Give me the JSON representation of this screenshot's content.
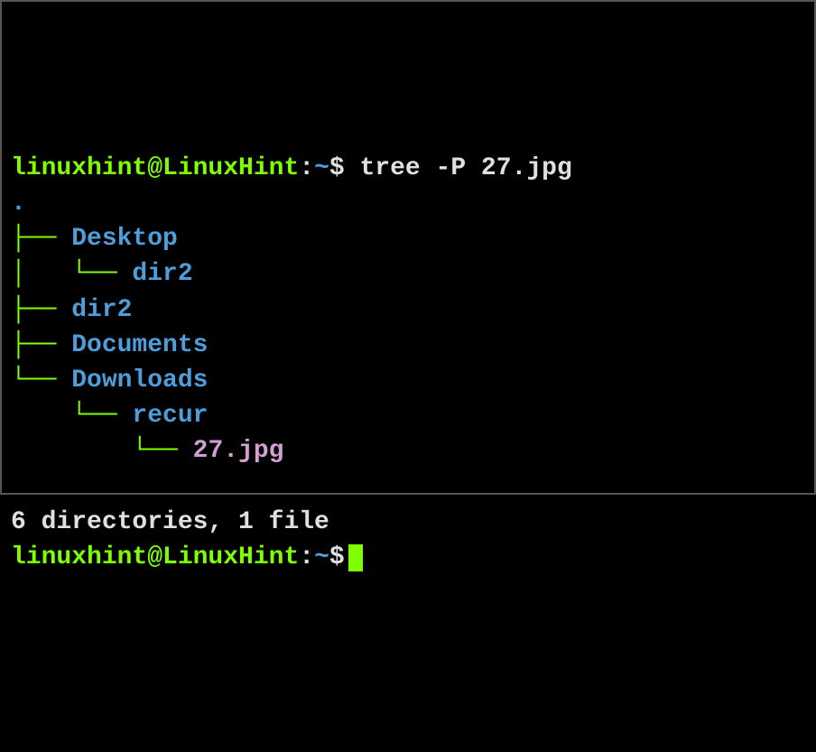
{
  "prompt1": {
    "user_host": "linuxhint@LinuxHint",
    "separator": ":",
    "path": "~",
    "dollar": "$",
    "command": " tree -P 27.jpg"
  },
  "tree": {
    "root": ".",
    "l1_prefix": "├── ",
    "l1_last_prefix": "└── ",
    "l2_prefix": "│   └── ",
    "l2_cont_prefix": "    └── ",
    "l3_cont_prefix": "        └── ",
    "entries": {
      "desktop": "Desktop",
      "desktop_dir2": "dir2",
      "dir2": "dir2",
      "documents": "Documents",
      "downloads": "Downloads",
      "recur": "recur",
      "file": "27.jpg"
    }
  },
  "summary": "6 directories, 1 file",
  "prompt2": {
    "user_host": "linuxhint@LinuxHint",
    "separator": ":",
    "path": "~",
    "dollar": "$"
  }
}
